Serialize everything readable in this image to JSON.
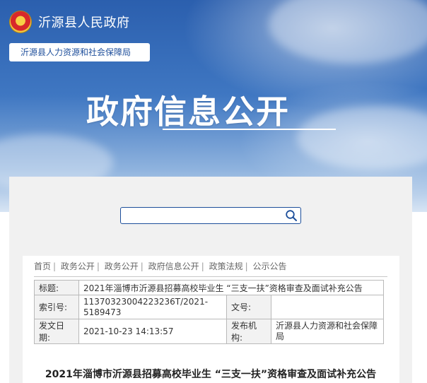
{
  "site": {
    "name": "沂源县人民政府",
    "department": "沂源县人力资源和社会保障局"
  },
  "hero": {
    "title": "政府信息公开"
  },
  "search": {
    "placeholder": ""
  },
  "breadcrumb": [
    "首页",
    "政务公开",
    "政务公开",
    "政府信息公开",
    "政策法规",
    "公示公告"
  ],
  "meta": {
    "title_label": "标题:",
    "title_value": "2021年淄博市沂源县招募高校毕业生 “三支一扶”资格审查及面试补充公告",
    "index_label": "索引号:",
    "index_value": "11370323004223236T/2021-5189473",
    "docno_label": "文号:",
    "docno_value": "",
    "date_label": "发文日期:",
    "date_value": "2021-10-23 14:13:57",
    "org_label": "发布机构:",
    "org_value": "沂源县人力资源和社会保障局"
  },
  "article": {
    "title": "2021年淄博市沂源县招募高校毕业生 “三支一扶”资格审查及面试补充公告"
  },
  "icons": {
    "emblem": "national-emblem",
    "search": "search-icon"
  }
}
